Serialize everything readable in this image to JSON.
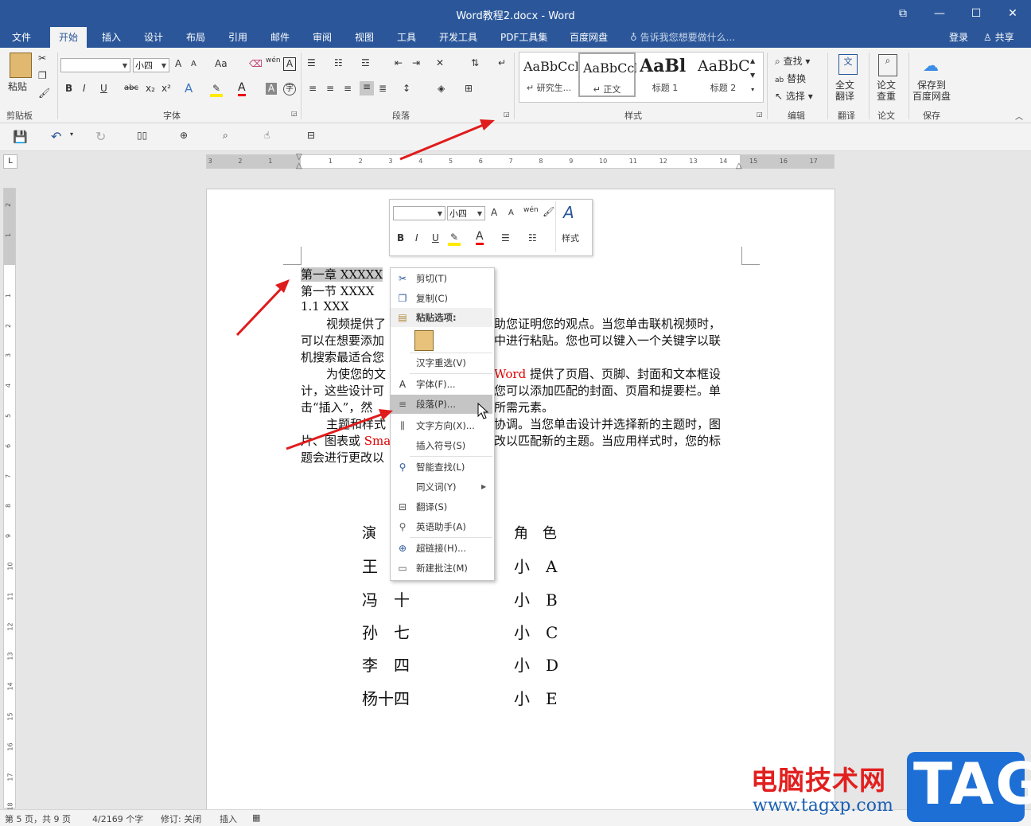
{
  "window": {
    "title": "Word教程2.docx - Word"
  },
  "tabs": [
    "文件",
    "开始",
    "插入",
    "设计",
    "布局",
    "引用",
    "邮件",
    "审阅",
    "视图",
    "工具",
    "开发工具",
    "PDF工具集",
    "百度网盘"
  ],
  "tell_me": "告诉我您想要做什么...",
  "account": {
    "login": "登录",
    "share": "共享"
  },
  "ribbon": {
    "clipboard": {
      "paste": "粘贴",
      "label": "剪贴板"
    },
    "font": {
      "size": "小四",
      "label": "字体",
      "bold": "B",
      "italic": "I",
      "underline": "U",
      "strike": "abc",
      "sub": "x₂",
      "sup": "x²",
      "grow": "A",
      "shrink": "A",
      "case": "Aa",
      "phonetic": "wén",
      "border_char": "A"
    },
    "paragraph": {
      "label": "段落"
    },
    "styles": {
      "label": "样式",
      "items": [
        {
          "sample": "AaBbCcDd",
          "name": "↵ 研究生..."
        },
        {
          "sample": "AaBbCcDd",
          "name": "↵ 正文"
        },
        {
          "sample": "AaBl",
          "name": "标题 1"
        },
        {
          "sample": "AaBbC",
          "name": "标题 2"
        }
      ]
    },
    "editing": {
      "find": "查找",
      "replace": "替换",
      "select": "选择",
      "label": "编辑"
    },
    "translate": {
      "btn": "全文\n翻译",
      "label": "翻译"
    },
    "paper": {
      "btn": "论文\n查重",
      "label": "论文"
    },
    "save": {
      "btn": "保存到\n百度网盘",
      "label": "保存"
    }
  },
  "ruler": {
    "ticks": [
      "3",
      "2",
      "1",
      "1",
      "2",
      "3",
      "4",
      "5",
      "6",
      "7",
      "8",
      "9",
      "10",
      "11",
      "12",
      "13",
      "14",
      "15",
      "16",
      "17"
    ]
  },
  "vruler": {
    "ticks": [
      "2",
      "1",
      "1",
      "2",
      "3",
      "4",
      "5",
      "6",
      "7",
      "8",
      "9",
      "10",
      "11",
      "12",
      "13",
      "14",
      "15",
      "16",
      "17",
      "18"
    ]
  },
  "document": {
    "line1": "第一章  XXXXX",
    "line2": "第一节  XXXX",
    "line3": "1.1 XXX",
    "p1_l1a": "视频提供了",
    "p1_l1b": "助您证明您的观点。当您单击联机视频时，",
    "p1_l2a": "可以在想要添加",
    "p1_l2b": "中进行粘贴。您也可以键入一个关键字以联",
    "p1_l3a": "机搜索最适合您",
    "p2_l1a": "为使您的文",
    "p2_l1red": "Word",
    "p2_l1b": " 提供了页眉、页脚、封面和文本框设",
    "p2_l2a": "计，这些设计可",
    "p2_l2b": "您可以添加匹配的封面、页眉和提要栏。单",
    "p2_l3a": "击“插入”，然",
    "p2_l3b": "所需元素。",
    "p3_l1a": "主题和样式",
    "p3_l1b": "协调。当您单击设计并选择新的主题时，图",
    "p3_l2a": "片、图表或 ",
    "p3_l2red": "Sma",
    "p3_l2b": "改以匹配新的主题。当应用样式时，您的标",
    "p3_l3a": "题会进行更改以",
    "table": {
      "left": [
        "演",
        "王",
        "冯　十",
        "孙　七",
        "李　四",
        "杨十四"
      ],
      "right": [
        "角　色",
        "小　A",
        "小　B",
        "小　C",
        "小　D",
        "小　E"
      ]
    }
  },
  "mini_toolbar": {
    "size": "小四",
    "styles": "样式"
  },
  "context_menu": [
    {
      "label": "剪切(T)",
      "icon": "scissors-icon"
    },
    {
      "label": "复制(C)",
      "icon": "copy-icon"
    },
    {
      "label": "粘贴选项:",
      "icon": "paste-icon"
    },
    {
      "label": "汉字重选(V)",
      "icon": ""
    },
    {
      "label": "字体(F)...",
      "icon": "font-icon"
    },
    {
      "label": "段落(P)...",
      "icon": "paragraph-icon"
    },
    {
      "label": "文字方向(X)...",
      "icon": "text-direction-icon"
    },
    {
      "label": "插入符号(S)",
      "icon": ""
    },
    {
      "label": "智能查找(L)",
      "icon": "smart-lookup-icon"
    },
    {
      "label": "同义词(Y)",
      "icon": ""
    },
    {
      "label": "翻译(S)",
      "icon": "translate-icon"
    },
    {
      "label": "英语助手(A)",
      "icon": "english-assistant-icon"
    },
    {
      "label": "超链接(H)...",
      "icon": "hyperlink-icon"
    },
    {
      "label": "新建批注(M)",
      "icon": "new-comment-icon"
    }
  ],
  "status": {
    "page": "第 5 页，共 9 页",
    "words": "4/2169 个字",
    "track": "修订: 关闭",
    "mode": "插入"
  },
  "watermark": {
    "cn": "电脑技术网",
    "url": "www.tagxp.com",
    "tag": "TAG"
  },
  "colors": {
    "brand": "#2b579a",
    "arrow": "#e01b1b"
  }
}
